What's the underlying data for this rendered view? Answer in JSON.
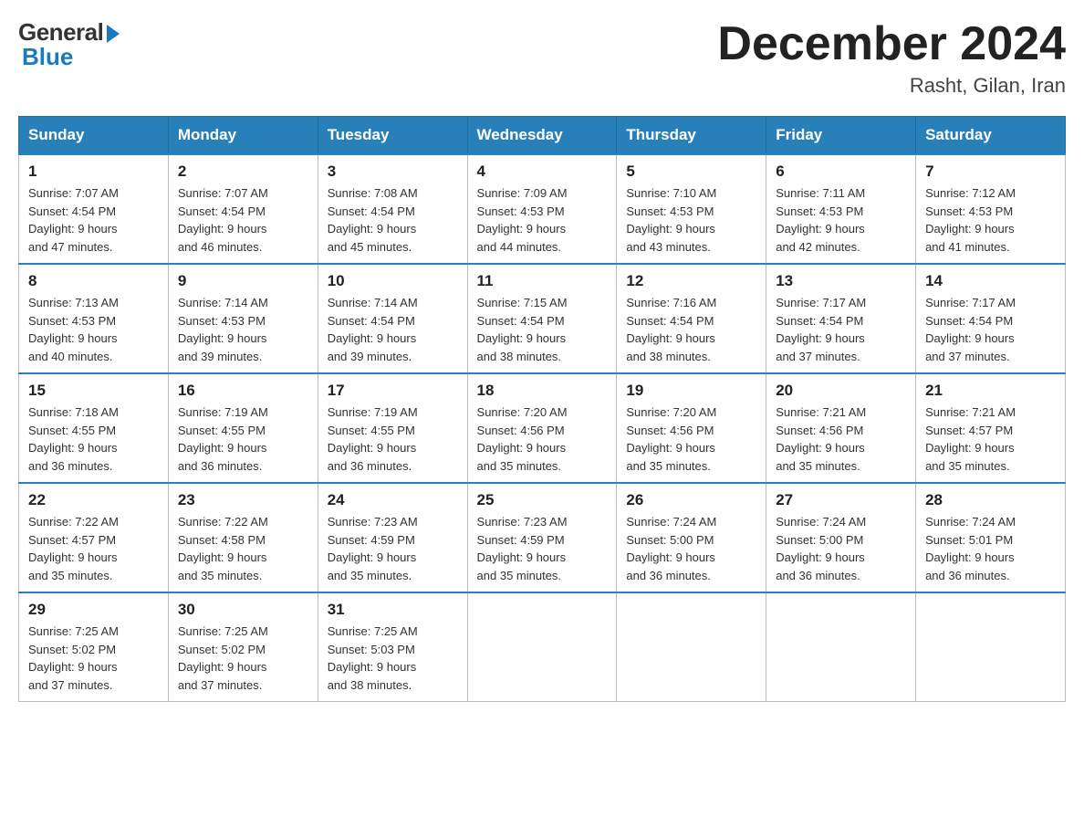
{
  "header": {
    "logo_general": "General",
    "logo_blue": "Blue",
    "main_title": "December 2024",
    "subtitle": "Rasht, Gilan, Iran"
  },
  "calendar": {
    "days_of_week": [
      "Sunday",
      "Monday",
      "Tuesday",
      "Wednesday",
      "Thursday",
      "Friday",
      "Saturday"
    ],
    "weeks": [
      [
        {
          "day": "1",
          "sunrise": "7:07 AM",
          "sunset": "4:54 PM",
          "daylight": "9 hours and 47 minutes."
        },
        {
          "day": "2",
          "sunrise": "7:07 AM",
          "sunset": "4:54 PM",
          "daylight": "9 hours and 46 minutes."
        },
        {
          "day": "3",
          "sunrise": "7:08 AM",
          "sunset": "4:54 PM",
          "daylight": "9 hours and 45 minutes."
        },
        {
          "day": "4",
          "sunrise": "7:09 AM",
          "sunset": "4:53 PM",
          "daylight": "9 hours and 44 minutes."
        },
        {
          "day": "5",
          "sunrise": "7:10 AM",
          "sunset": "4:53 PM",
          "daylight": "9 hours and 43 minutes."
        },
        {
          "day": "6",
          "sunrise": "7:11 AM",
          "sunset": "4:53 PM",
          "daylight": "9 hours and 42 minutes."
        },
        {
          "day": "7",
          "sunrise": "7:12 AM",
          "sunset": "4:53 PM",
          "daylight": "9 hours and 41 minutes."
        }
      ],
      [
        {
          "day": "8",
          "sunrise": "7:13 AM",
          "sunset": "4:53 PM",
          "daylight": "9 hours and 40 minutes."
        },
        {
          "day": "9",
          "sunrise": "7:14 AM",
          "sunset": "4:53 PM",
          "daylight": "9 hours and 39 minutes."
        },
        {
          "day": "10",
          "sunrise": "7:14 AM",
          "sunset": "4:54 PM",
          "daylight": "9 hours and 39 minutes."
        },
        {
          "day": "11",
          "sunrise": "7:15 AM",
          "sunset": "4:54 PM",
          "daylight": "9 hours and 38 minutes."
        },
        {
          "day": "12",
          "sunrise": "7:16 AM",
          "sunset": "4:54 PM",
          "daylight": "9 hours and 38 minutes."
        },
        {
          "day": "13",
          "sunrise": "7:17 AM",
          "sunset": "4:54 PM",
          "daylight": "9 hours and 37 minutes."
        },
        {
          "day": "14",
          "sunrise": "7:17 AM",
          "sunset": "4:54 PM",
          "daylight": "9 hours and 37 minutes."
        }
      ],
      [
        {
          "day": "15",
          "sunrise": "7:18 AM",
          "sunset": "4:55 PM",
          "daylight": "9 hours and 36 minutes."
        },
        {
          "day": "16",
          "sunrise": "7:19 AM",
          "sunset": "4:55 PM",
          "daylight": "9 hours and 36 minutes."
        },
        {
          "day": "17",
          "sunrise": "7:19 AM",
          "sunset": "4:55 PM",
          "daylight": "9 hours and 36 minutes."
        },
        {
          "day": "18",
          "sunrise": "7:20 AM",
          "sunset": "4:56 PM",
          "daylight": "9 hours and 35 minutes."
        },
        {
          "day": "19",
          "sunrise": "7:20 AM",
          "sunset": "4:56 PM",
          "daylight": "9 hours and 35 minutes."
        },
        {
          "day": "20",
          "sunrise": "7:21 AM",
          "sunset": "4:56 PM",
          "daylight": "9 hours and 35 minutes."
        },
        {
          "day": "21",
          "sunrise": "7:21 AM",
          "sunset": "4:57 PM",
          "daylight": "9 hours and 35 minutes."
        }
      ],
      [
        {
          "day": "22",
          "sunrise": "7:22 AM",
          "sunset": "4:57 PM",
          "daylight": "9 hours and 35 minutes."
        },
        {
          "day": "23",
          "sunrise": "7:22 AM",
          "sunset": "4:58 PM",
          "daylight": "9 hours and 35 minutes."
        },
        {
          "day": "24",
          "sunrise": "7:23 AM",
          "sunset": "4:59 PM",
          "daylight": "9 hours and 35 minutes."
        },
        {
          "day": "25",
          "sunrise": "7:23 AM",
          "sunset": "4:59 PM",
          "daylight": "9 hours and 35 minutes."
        },
        {
          "day": "26",
          "sunrise": "7:24 AM",
          "sunset": "5:00 PM",
          "daylight": "9 hours and 36 minutes."
        },
        {
          "day": "27",
          "sunrise": "7:24 AM",
          "sunset": "5:00 PM",
          "daylight": "9 hours and 36 minutes."
        },
        {
          "day": "28",
          "sunrise": "7:24 AM",
          "sunset": "5:01 PM",
          "daylight": "9 hours and 36 minutes."
        }
      ],
      [
        {
          "day": "29",
          "sunrise": "7:25 AM",
          "sunset": "5:02 PM",
          "daylight": "9 hours and 37 minutes."
        },
        {
          "day": "30",
          "sunrise": "7:25 AM",
          "sunset": "5:02 PM",
          "daylight": "9 hours and 37 minutes."
        },
        {
          "day": "31",
          "sunrise": "7:25 AM",
          "sunset": "5:03 PM",
          "daylight": "9 hours and 38 minutes."
        },
        null,
        null,
        null,
        null
      ]
    ],
    "labels": {
      "sunrise": "Sunrise: ",
      "sunset": "Sunset: ",
      "daylight": "Daylight: "
    }
  }
}
